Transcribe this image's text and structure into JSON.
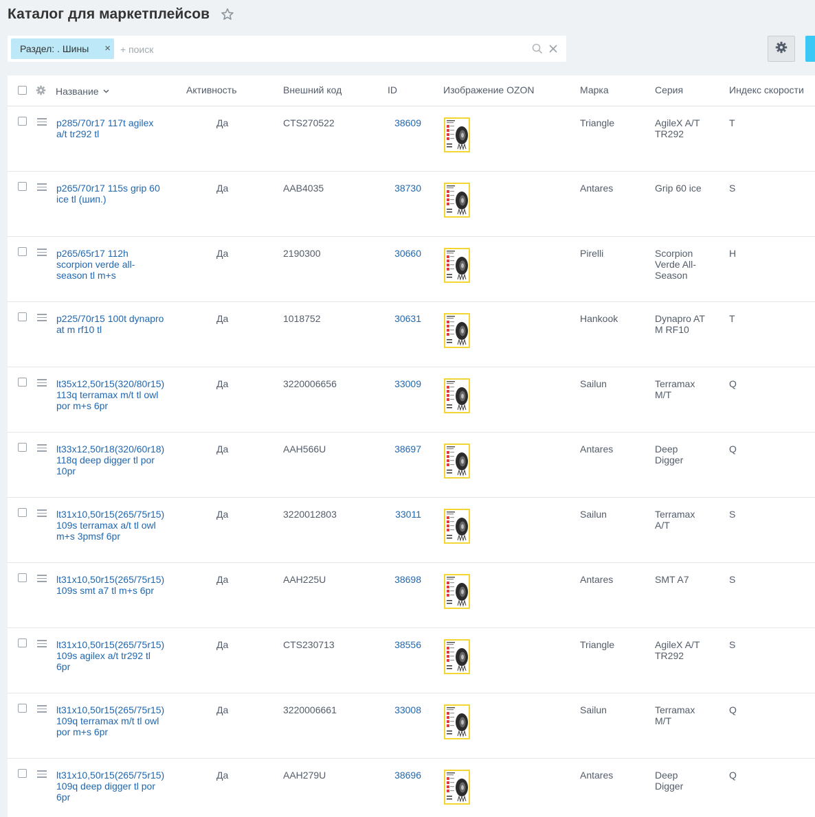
{
  "page": {
    "title": "Каталог для маркетплейсов"
  },
  "filter": {
    "chip_label": "Раздел: . Шины",
    "chip_close": "×",
    "search_placeholder": "+ поиск"
  },
  "colors": {
    "link": "#2067b0",
    "chip": "#bce8f7",
    "accent": "#3bc8f5",
    "thumb_border": "#f5d534"
  },
  "icons": [
    "star-icon",
    "search-icon",
    "clear-icon",
    "gear-icon",
    "drag-handle-icon",
    "sort-arrow-icon"
  ],
  "columns": {
    "name": "Название",
    "active": "Активность",
    "code": "Внешний код",
    "id": "ID",
    "image": "Изображение OZON",
    "brand": "Марка",
    "series": "Серия",
    "speed": "Индекс скорости"
  },
  "rows": [
    {
      "name": [
        "p285/70r17 117t agilex",
        "a/t tr292 tl"
      ],
      "active": "Да",
      "code": "CTS270522",
      "id": "38609",
      "brand": "Triangle",
      "series": [
        "AgileX A/T",
        "TR292"
      ],
      "speed": "T"
    },
    {
      "name": [
        "p265/70r17 115s grip 60",
        "ice tl (шип.)"
      ],
      "active": "Да",
      "code": "AAB4035",
      "id": "38730",
      "brand": "Antares",
      "series": [
        "Grip 60 ice"
      ],
      "speed": "S"
    },
    {
      "name": [
        "p265/65r17 112h",
        "scorpion verde all-",
        "season tl m+s"
      ],
      "active": "Да",
      "code": "2190300",
      "id": "30660",
      "brand": "Pirelli",
      "series": [
        "Scorpion",
        "Verde All-",
        "Season"
      ],
      "speed": "H"
    },
    {
      "name": [
        "p225/70r15 100t dynapro",
        "at m rf10 tl"
      ],
      "active": "Да",
      "code": "1018752",
      "id": "30631",
      "brand": "Hankook",
      "series": [
        "Dynapro AT",
        "M RF10"
      ],
      "speed": "T"
    },
    {
      "name": [
        "lt35x12,50r15(320/80r15)",
        "113q terramax m/t tl owl",
        "por m+s 6pr"
      ],
      "active": "Да",
      "code": "3220006656",
      "id": "33009",
      "brand": "Sailun",
      "series": [
        "Terramax",
        "M/T"
      ],
      "speed": "Q"
    },
    {
      "name": [
        "lt33x12,50r18(320/60r18)",
        "118q deep digger tl por",
        "10pr"
      ],
      "active": "Да",
      "code": "AAH566U",
      "id": "38697",
      "brand": "Antares",
      "series": [
        "Deep",
        "Digger"
      ],
      "speed": "Q"
    },
    {
      "name": [
        "lt31x10,50r15(265/75r15)",
        "109s terramax a/t tl owl",
        "m+s 3pmsf 6pr"
      ],
      "active": "Да",
      "code": "3220012803",
      "id": "33011",
      "brand": "Sailun",
      "series": [
        "Terramax",
        "A/T"
      ],
      "speed": "S"
    },
    {
      "name": [
        "lt31x10,50r15(265/75r15)",
        "109s smt a7 tl m+s 6pr"
      ],
      "active": "Да",
      "code": "AAH225U",
      "id": "38698",
      "brand": "Antares",
      "series": [
        "SMT A7"
      ],
      "speed": "S"
    },
    {
      "name": [
        "lt31x10,50r15(265/75r15)",
        "109s agilex a/t tr292 tl",
        "6pr"
      ],
      "active": "Да",
      "code": "CTS230713",
      "id": "38556",
      "brand": "Triangle",
      "series": [
        "AgileX A/T",
        "TR292"
      ],
      "speed": "S"
    },
    {
      "name": [
        "lt31x10,50r15(265/75r15)",
        "109q terramax m/t tl owl",
        "por m+s 6pr"
      ],
      "active": "Да",
      "code": "3220006661",
      "id": "33008",
      "brand": "Sailun",
      "series": [
        "Terramax",
        "M/T"
      ],
      "speed": "Q"
    },
    {
      "name": [
        "lt31x10,50r15(265/75r15)",
        "109q deep digger tl por",
        "6pr"
      ],
      "active": "Да",
      "code": "AAH279U",
      "id": "38696",
      "brand": "Antares",
      "series": [
        "Deep",
        "Digger"
      ],
      "speed": "Q"
    }
  ]
}
